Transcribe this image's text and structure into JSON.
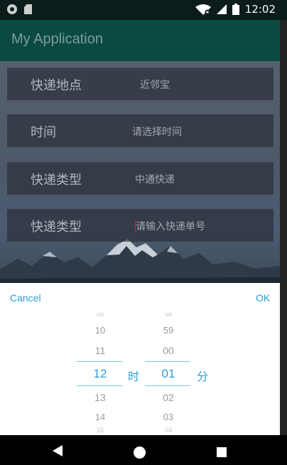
{
  "status_bar": {
    "time": "12:02"
  },
  "app_bar": {
    "title": "My Application"
  },
  "form": {
    "rows": [
      {
        "label": "快递地点",
        "value": "近邻宝"
      },
      {
        "label": "时间",
        "value": "请选择时间"
      },
      {
        "label": "快递类型",
        "value": "中通快递"
      },
      {
        "label": "快递类型",
        "value": "请输入快递单号"
      }
    ]
  },
  "picker": {
    "cancel_label": "Cancel",
    "ok_label": "OK",
    "hour": {
      "above": [
        "09",
        "10",
        "11"
      ],
      "selected": "12",
      "below": [
        "13",
        "14",
        "15"
      ],
      "unit": "时"
    },
    "minute": {
      "above": [
        "58",
        "59",
        "00"
      ],
      "selected": "01",
      "below": [
        "02",
        "03",
        "04"
      ],
      "unit": "分"
    }
  },
  "colors": {
    "accent": "#2aa0d5",
    "app_bar": "#0b4a42",
    "status_bar": "#0c1c1a"
  }
}
